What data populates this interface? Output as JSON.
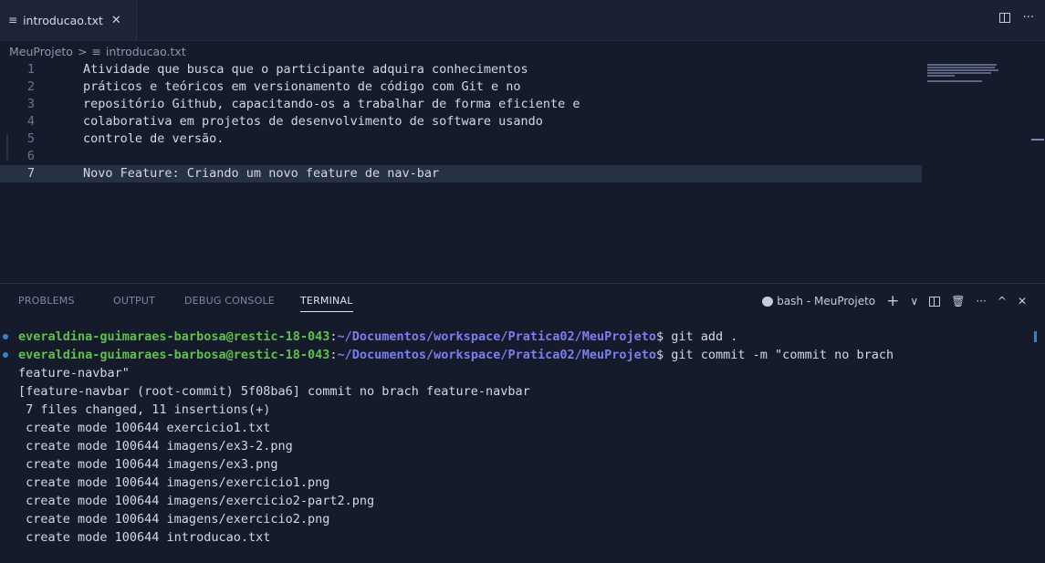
{
  "tab": {
    "title": "introducao.txt",
    "icon": "lines-icon",
    "close": "✕"
  },
  "tabbar": {
    "more": "···"
  },
  "breadcrumb": {
    "folder": "MeuProjeto",
    "separator": ">",
    "file": "introducao.txt"
  },
  "editor": {
    "lines": [
      {
        "num": "1",
        "text": "Atividade que busca que o participante adquira conhecimentos"
      },
      {
        "num": "2",
        "text": "práticos e teóricos em versionamento de código com Git e no"
      },
      {
        "num": "3",
        "text": "repositório Github, capacitando-os a trabalhar de forma eficiente e"
      },
      {
        "num": "4",
        "text": "colaborativa em projetos de desenvolvimento de software usando"
      },
      {
        "num": "5",
        "text": "controle de versão."
      },
      {
        "num": "6",
        "text": ""
      },
      {
        "num": "7",
        "text": "Novo Feature: Criando um novo feature de nav-bar"
      }
    ],
    "active_line": "7"
  },
  "panel": {
    "tabs": [
      "PROBLEMS",
      "OUTPUT",
      "DEBUG CONSOLE",
      "TERMINAL"
    ],
    "active_tab": "TERMINAL",
    "terminal_name": "bash - MeuProjeto",
    "plus": "+",
    "chevron": "∨",
    "more": "···",
    "up": "^",
    "close": "✕"
  },
  "terminal": {
    "prompt1": {
      "user": "everaldina-guimaraes-barbosa@restic-18-043",
      "path": "~/Documentos/workspace/Pratica02/MeuProjeto",
      "cmd": "$ git add ."
    },
    "prompt2": {
      "user": "everaldina-guimaraes-barbosa@restic-18-043",
      "path": "~/Documentos/workspace/Pratica02/MeuProjeto",
      "cmd": "$ git commit -m \"commit no brach"
    },
    "output": [
      "feature-navbar\"",
      "[feature-navbar (root-commit) 5f08ba6] commit no brach feature-navbar",
      " 7 files changed, 11 insertions(+)",
      " create mode 100644 exercicio1.txt",
      " create mode 100644 imagens/ex3-2.png",
      " create mode 100644 imagens/ex3.png",
      " create mode 100644 imagens/exercicio1.png",
      " create mode 100644 imagens/exercicio2-part2.png",
      " create mode 100644 imagens/exercicio2.png",
      " create mode 100644 introducao.txt"
    ]
  }
}
